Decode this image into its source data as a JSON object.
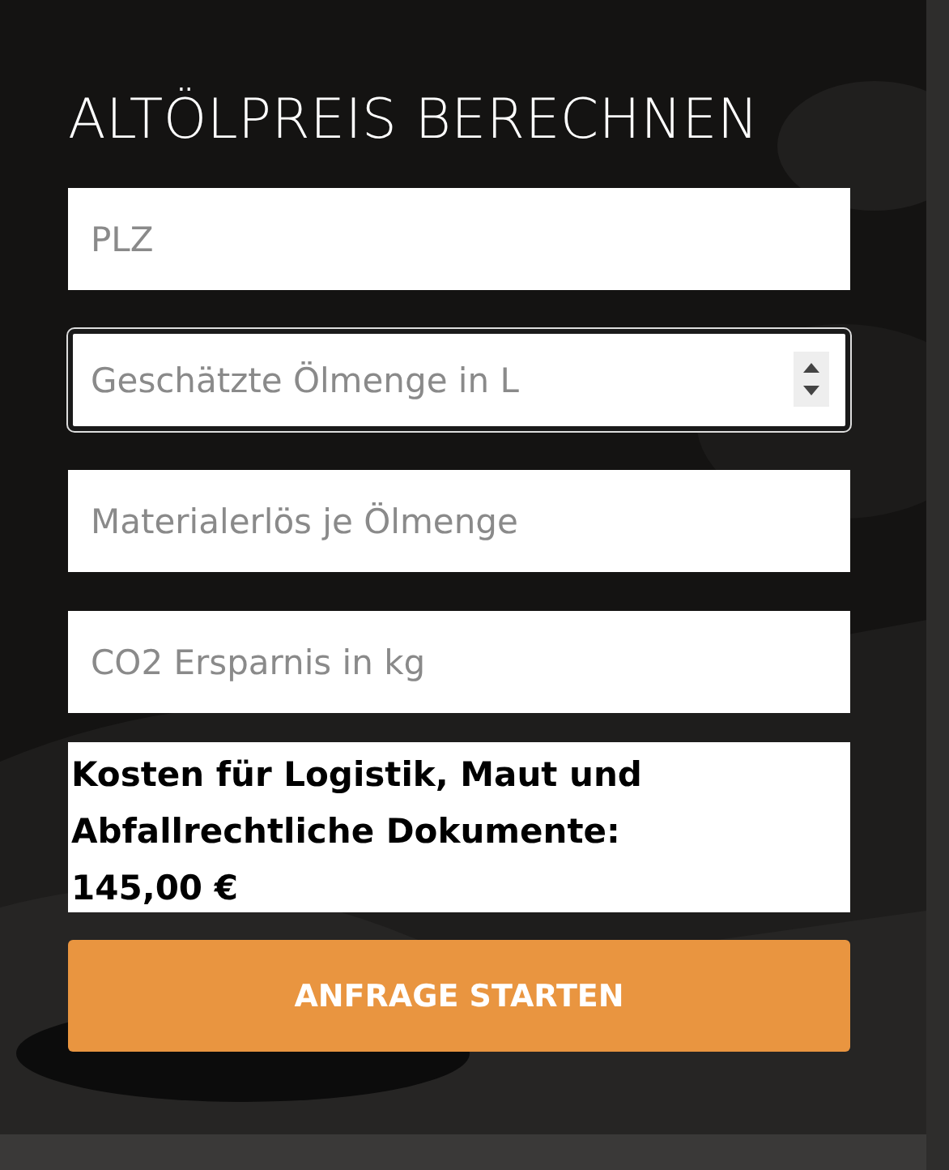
{
  "title": "ALTÖLPREIS BERECHNEN",
  "fields": [
    {
      "kind": "text",
      "placeholder": "PLZ",
      "focused": false
    },
    {
      "kind": "number",
      "placeholder": "Geschätzte Ölmenge in L",
      "focused": true
    },
    {
      "kind": "text",
      "placeholder": "Materialerlös je Ölmenge",
      "focused": false
    },
    {
      "kind": "text",
      "placeholder": "CO2 Ersparnis in kg",
      "focused": false
    }
  ],
  "cost_note": "Kosten für Logistik, Maut und Abfallrechtliche Dokumente: 145,00 €",
  "submit_button": "ANFRAGE STARTEN"
}
